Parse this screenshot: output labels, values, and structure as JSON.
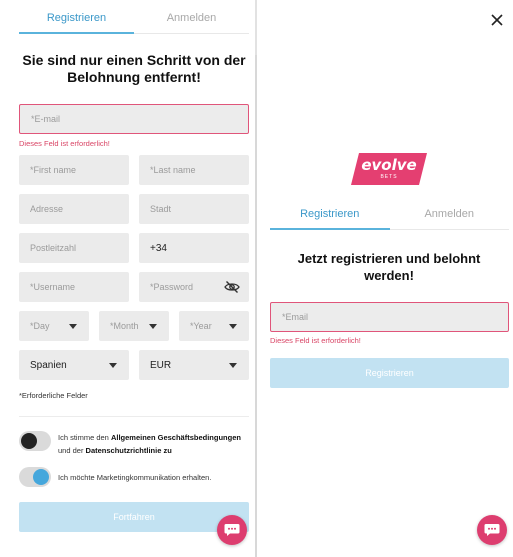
{
  "colors": {
    "accent": "#5ab3dc",
    "error": "#e0557a",
    "brand": "#dd3d6f",
    "button": "#c2e2f2"
  },
  "left": {
    "tabs": [
      {
        "label": "Registrieren",
        "active": true
      },
      {
        "label": "Anmelden",
        "active": false
      }
    ],
    "heading": "Sie sind nur einen Schritt von der Belohnung entfernt!",
    "email_placeholder": "*E-mail",
    "email_error": "Dieses Feld ist erforderlich!",
    "first_name_placeholder": "*First name",
    "last_name_placeholder": "*Last name",
    "address_placeholder": "Adresse",
    "city_placeholder": "Stadt",
    "postcode_placeholder": "Postleitzahl",
    "phone_prefix": "+34",
    "username_placeholder": "*Username",
    "password_placeholder": "*Password",
    "day_placeholder": "*Day",
    "month_placeholder": "*Month",
    "year_placeholder": "*Year",
    "country_value": "Spanien",
    "currency_value": "EUR",
    "required_note": "*Erforderliche Felder",
    "terms": {
      "part1": "Ich stimme den ",
      "link1": "Allgemeinen Geschäftsbedingungen",
      "part2": "und der ",
      "link2": "Datenschutzrichtlinie zu",
      "checked": false
    },
    "marketing": {
      "label": "Ich möchte Marketingkommunikation erhalten.",
      "checked": true
    },
    "submit_label": "Fortfahren"
  },
  "right": {
    "logo": {
      "word": "evolve",
      "sub": "BETS"
    },
    "tabs": [
      {
        "label": "Registrieren",
        "active": true
      },
      {
        "label": "Anmelden",
        "active": false
      }
    ],
    "heading": "Jetzt registrieren und belohnt werden!",
    "email_placeholder": "*Email",
    "email_error": "Dieses Feld ist erforderlich!",
    "submit_label": "Registrieren"
  },
  "icons": {
    "close": "close-icon",
    "chat": "chat-bubble-icon",
    "eye": "eye-slash-icon",
    "chevron": "chevron-down-icon"
  }
}
